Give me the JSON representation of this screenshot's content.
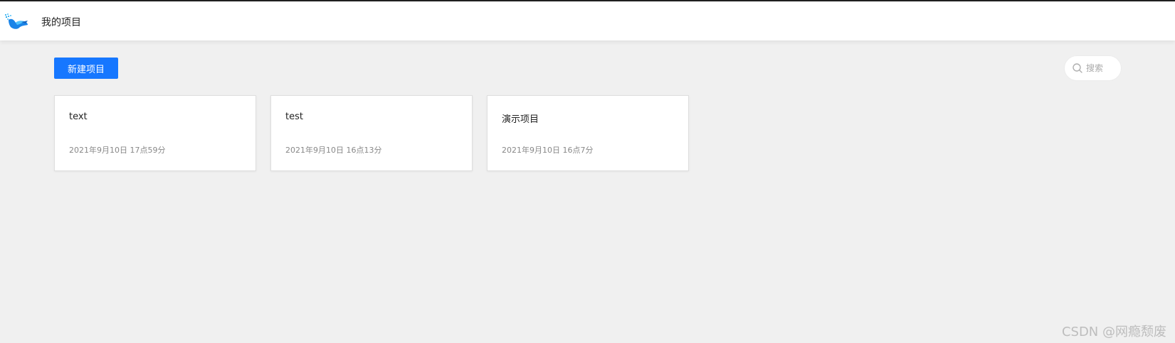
{
  "header": {
    "logo_icon": "brand-logo-icon",
    "title": "我的项目"
  },
  "toolbar": {
    "new_project_label": "新建项目",
    "accent_color": "#1677ff"
  },
  "search": {
    "icon": "search-icon",
    "placeholder": "搜索"
  },
  "projects": [
    {
      "name": "text",
      "created": "2021年9月10日 17点59分"
    },
    {
      "name": "test",
      "created": "2021年9月10日 16点13分"
    },
    {
      "name": "演示项目",
      "created": "2021年9月10日 16点7分"
    }
  ],
  "watermark": "CSDN @网瘾颓废"
}
